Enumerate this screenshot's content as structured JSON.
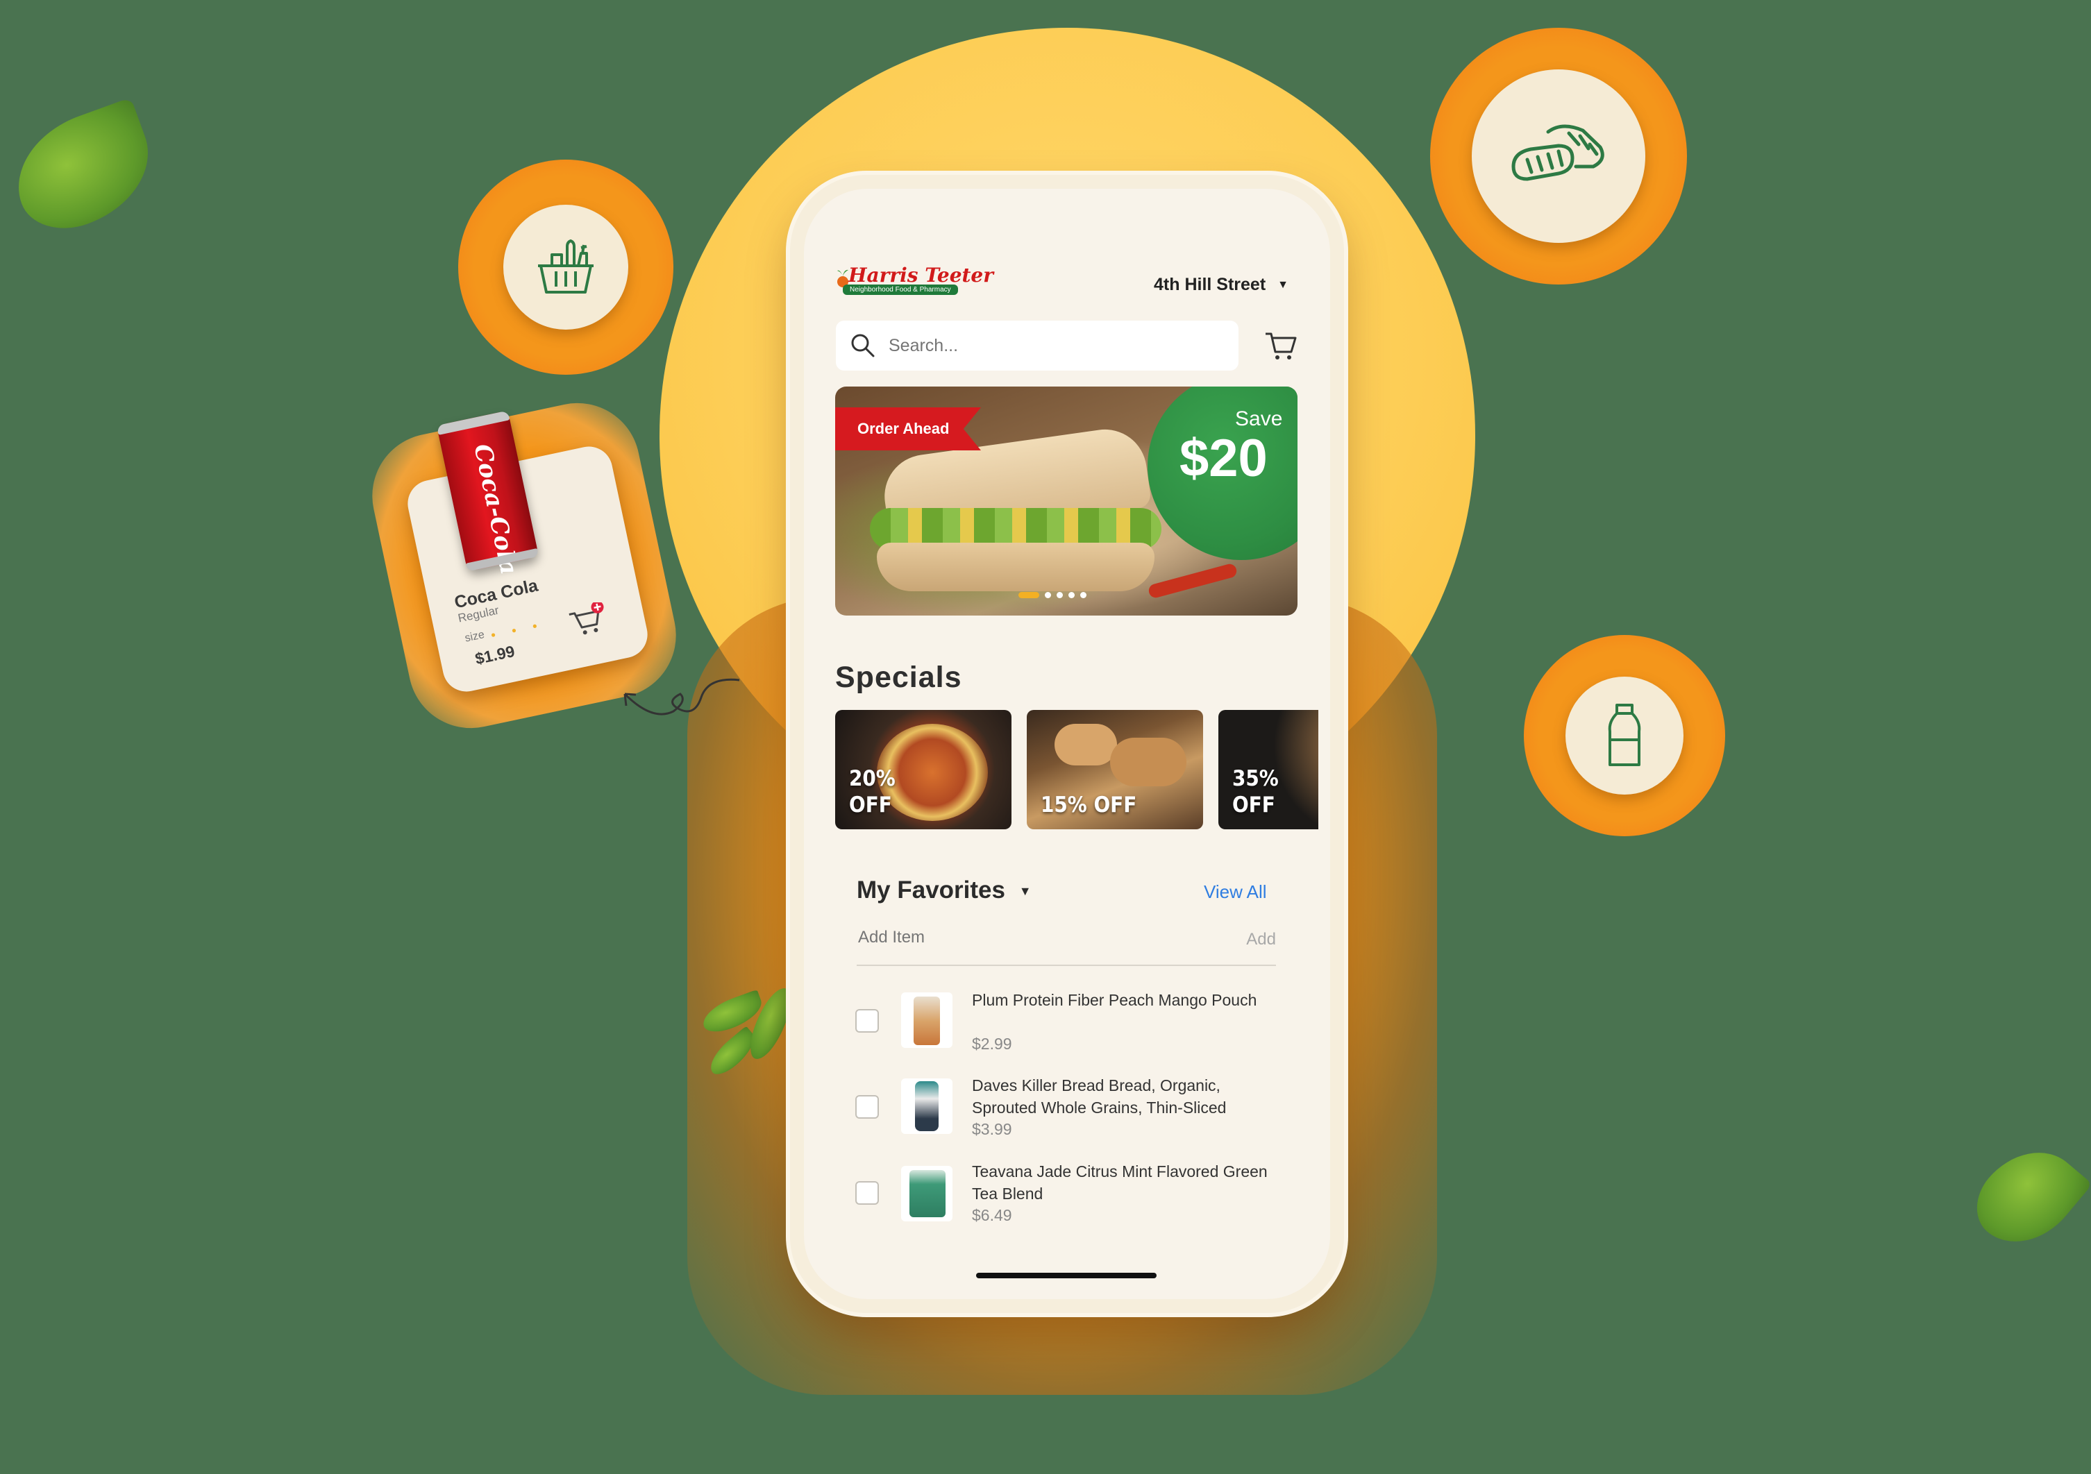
{
  "app": {
    "brand_name": "Harris Teeter",
    "brand_tagline": "Neighborhood Food & Pharmacy",
    "location": "4th Hill Street"
  },
  "search": {
    "placeholder": "Search..."
  },
  "banner": {
    "tag": "Order Ahead",
    "save_label": "Save",
    "save_amount": "$20",
    "slide_count": 5,
    "active_slide": 1
  },
  "specials": {
    "title": "Specials",
    "items": [
      {
        "line1": "20%",
        "line2": "OFF",
        "image": "pizza"
      },
      {
        "line1": "15% OFF",
        "line2": "",
        "image": "bread"
      },
      {
        "line1": "35%",
        "line2": "OFF",
        "image": "snack"
      }
    ]
  },
  "favorites": {
    "title": "My Favorites",
    "view_all": "View All",
    "add_item_placeholder": "Add Item",
    "add_button": "Add",
    "items": [
      {
        "name": "Plum Protein Fiber Peach Mango Pouch",
        "price": "$2.99",
        "checked": false
      },
      {
        "name": "Daves Killer Bread Bread, Organic, Sprouted Whole Grains, Thin-Sliced",
        "price": "$3.99",
        "checked": false
      },
      {
        "name": "Teavana Jade Citrus Mint Flavored Green Tea Blend",
        "price": "$6.49",
        "checked": false
      }
    ]
  },
  "promo_card": {
    "product": "Coca Cola",
    "variant": "Regular",
    "size_label": "size",
    "price": "$1.99",
    "can_logo": "Coca-Cola"
  },
  "floating_icons": [
    "grocery-basket-icon",
    "bread-icon",
    "milk-bottle-icon"
  ],
  "colors": {
    "background": "#4a7350",
    "accent_orange": "#f4961b",
    "sun_yellow": "#fdcd55",
    "brand_green": "#1f7a3a",
    "brand_red": "#d11a1a",
    "link_blue": "#2f7de1"
  }
}
